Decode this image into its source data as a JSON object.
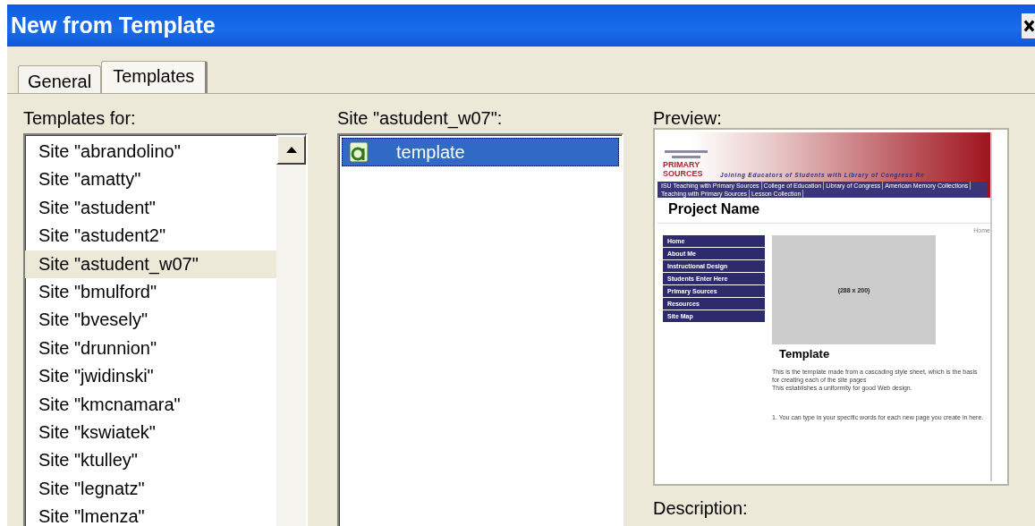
{
  "window": {
    "title": "New from Template"
  },
  "tabs": [
    {
      "label": "General",
      "selected": false
    },
    {
      "label": "Templates",
      "selected": true
    }
  ],
  "sites": {
    "label": "Templates for:",
    "items": [
      {
        "label": "Site \"abrandolino\"",
        "selected": false
      },
      {
        "label": "Site \"amatty\"",
        "selected": false
      },
      {
        "label": "Site \"astudent\"",
        "selected": false
      },
      {
        "label": "Site \"astudent2\"",
        "selected": false
      },
      {
        "label": "Site \"astudent_w07\"",
        "selected": true
      },
      {
        "label": "Site \"bmulford\"",
        "selected": false
      },
      {
        "label": "Site \"bvesely\"",
        "selected": false
      },
      {
        "label": "Site \"drunnion\"",
        "selected": false
      },
      {
        "label": "Site \"jwidinski\"",
        "selected": false
      },
      {
        "label": "Site \"kmcnamara\"",
        "selected": false
      },
      {
        "label": "Site \"kswiatek\"",
        "selected": false
      },
      {
        "label": "Site \"ktulley\"",
        "selected": false
      },
      {
        "label": "Site \"legnatz\"",
        "selected": false
      },
      {
        "label": "Site \"lmenza\"",
        "selected": false
      }
    ]
  },
  "templates": {
    "label": "Site \"astudent_w07\":",
    "items": [
      {
        "label": "template",
        "selected": true
      }
    ]
  },
  "preview": {
    "label": "Preview:",
    "page": {
      "logo": "PRIMARY SOURCES",
      "tagline": "Joining Educators of Students with Library of Congress Re",
      "nav_links": [
        "ISU Teaching with Primary Sources",
        "College of Education",
        "Library of Congress",
        "American Memory Collections",
        "Teaching with Primary Sources",
        "Lesson Collection"
      ],
      "heading": "Project Name",
      "breadcrumb": "Home",
      "menu": [
        "Home",
        "About Me",
        "Instructional Design",
        "Students Enter Here",
        "Primary Sources",
        "Resources",
        "Site Map"
      ],
      "image_caption": "(288 x 200)",
      "section_title": "Template",
      "paragraph_lines": [
        "This is the template made from a cascading style sheet, which is the basis for creating each of the site pages",
        "This establishes a uniformity for good Web design."
      ],
      "note": "1. You can type in your specific words for each new page you create in here."
    }
  },
  "description": {
    "label": "Description:"
  }
}
